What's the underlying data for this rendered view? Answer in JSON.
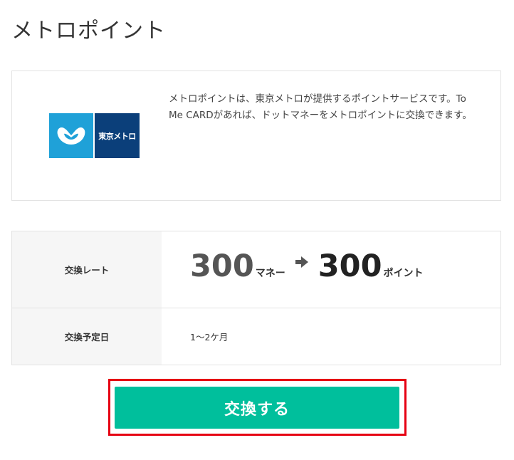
{
  "page": {
    "title": "メトロポイント"
  },
  "info": {
    "logo_text": "東京メトロ",
    "description": "メトロポイントは、東京メトロが提供するポイントサービスです。To Me CARDがあれば、ドットマネーをメトロポイントに交換できます。"
  },
  "rate_table": {
    "rate_label": "交換レート",
    "from_amount": "300",
    "from_unit": "マネー",
    "to_amount": "300",
    "to_unit": "ポイント",
    "date_label": "交換予定日",
    "date_value": "1〜2ケ月"
  },
  "actions": {
    "exchange_label": "交換する"
  },
  "colors": {
    "button": "#00bf9c",
    "highlight": "#e60012",
    "logo_light": "#1fa1d8",
    "logo_dark": "#0b3f7a"
  },
  "icons": {
    "logo_mark": "metro-m-logo-icon",
    "arrow": "arrow-right-icon"
  }
}
